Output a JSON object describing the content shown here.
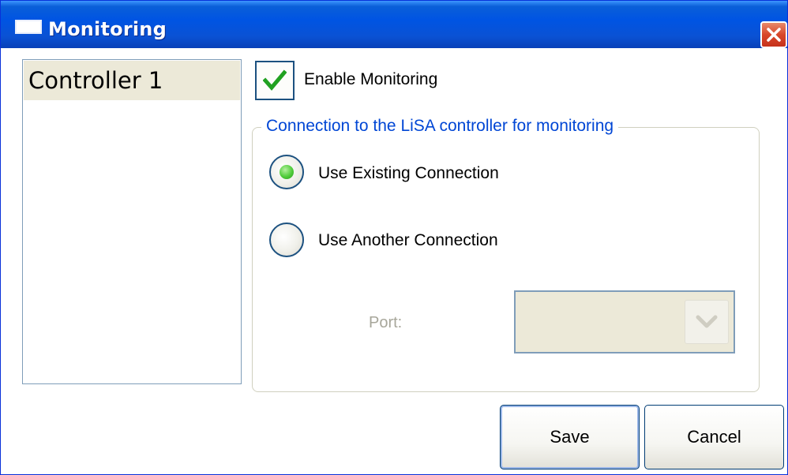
{
  "window": {
    "title": "Monitoring"
  },
  "controllers": [
    {
      "label": "Controller 1",
      "selected": true
    }
  ],
  "enable_monitoring": {
    "label": "Enable Monitoring",
    "checked": true
  },
  "connection_group": {
    "legend": "Connection to the LiSA controller for monitoring",
    "options": [
      {
        "label": "Use Existing Connection",
        "selected": true
      },
      {
        "label": "Use Another Connection",
        "selected": false
      }
    ],
    "port": {
      "label": "Port:",
      "value": "",
      "enabled": false
    }
  },
  "buttons": {
    "save": "Save",
    "cancel": "Cancel"
  },
  "colors": {
    "titlebar": "#0054e3",
    "legend": "#0046d5",
    "selection": "#ece9d8",
    "close": "#d8472b"
  }
}
